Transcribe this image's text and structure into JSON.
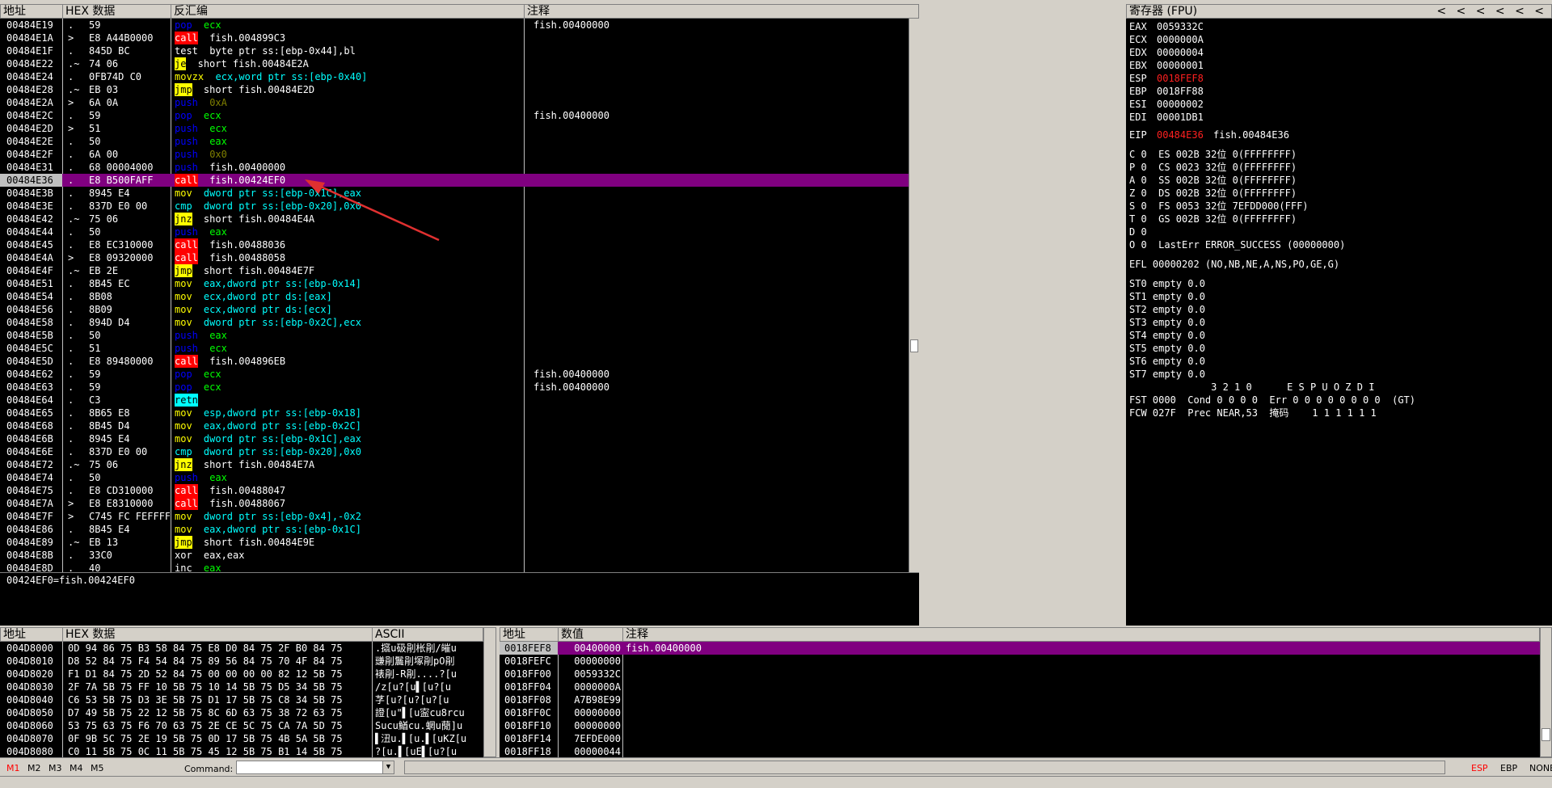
{
  "disasm": {
    "headers": {
      "addr": "地址",
      "hex": "HEX 数据",
      "asm": "反汇编",
      "comment": "注释"
    },
    "rows": [
      {
        "addr": "00484E19",
        "g": ".",
        "hex": "59",
        "mn": "pop",
        "mnc": "pop",
        "ops": "ecx",
        "opc": "reg",
        "cmt": "fish.00400000"
      },
      {
        "addr": "00484E1A",
        "g": ">",
        "hex": "E8 A44B0000",
        "mn": "call",
        "mnc": "call",
        "ops": "fish.004899C3",
        "opc": "",
        "cmt": ""
      },
      {
        "addr": "00484E1F",
        "g": ".",
        "hex": "845D BC",
        "mn": "test",
        "mnc": "test",
        "ops": "byte ptr ss:[ebp-0x44],bl",
        "opc": "",
        "cmt": ""
      },
      {
        "addr": "00484E22",
        "g": ".~",
        "hex": "74 06",
        "mn": "je",
        "mnc": "jcc",
        "ops": "short fish.00484E2A",
        "opc": "",
        "cmt": ""
      },
      {
        "addr": "00484E24",
        "g": ".",
        "hex": "0FB74D C0",
        "mn": "movzx",
        "mnc": "mov",
        "ops": "ecx,word ptr ss:[ebp-0x40]",
        "opc": "mem",
        "cmt": ""
      },
      {
        "addr": "00484E28",
        "g": ".~",
        "hex": "EB 03",
        "mn": "jmp",
        "mnc": "jmp",
        "ops": "short fish.00484E2D",
        "opc": "",
        "cmt": ""
      },
      {
        "addr": "00484E2A",
        "g": ">",
        "hex": "6A 0A",
        "mn": "push",
        "mnc": "push",
        "ops": "0xA",
        "opc": "imm",
        "cmt": ""
      },
      {
        "addr": "00484E2C",
        "g": ".",
        "hex": "59",
        "mn": "pop",
        "mnc": "pop",
        "ops": "ecx",
        "opc": "reg",
        "cmt": "fish.00400000"
      },
      {
        "addr": "00484E2D",
        "g": ">",
        "hex": "51",
        "mn": "push",
        "mnc": "push",
        "ops": "ecx",
        "opc": "reg",
        "cmt": ""
      },
      {
        "addr": "00484E2E",
        "g": ".",
        "hex": "50",
        "mn": "push",
        "mnc": "push",
        "ops": "eax",
        "opc": "reg",
        "cmt": ""
      },
      {
        "addr": "00484E2F",
        "g": ".",
        "hex": "6A 00",
        "mn": "push",
        "mnc": "push",
        "ops": "0x0",
        "opc": "imm",
        "cmt": ""
      },
      {
        "addr": "00484E31",
        "g": ".",
        "hex": "68 00004000",
        "mn": "push",
        "mnc": "push",
        "ops": "fish.00400000",
        "opc": "",
        "cmt": ""
      },
      {
        "addr": "00484E36",
        "g": ".",
        "hex": "E8 B500FAFF",
        "mn": "call",
        "mnc": "call",
        "ops": "fish.00424EF0",
        "opc": "",
        "cmt": "",
        "sel": true
      },
      {
        "addr": "00484E3B",
        "g": ".",
        "hex": "8945 E4",
        "mn": "mov",
        "mnc": "mov",
        "ops": "dword ptr ss:[ebp-0x1C],eax",
        "opc": "mem",
        "cmt": ""
      },
      {
        "addr": "00484E3E",
        "g": ".",
        "hex": "837D E0 00",
        "mn": "cmp",
        "mnc": "cmp",
        "ops": "dword ptr ss:[ebp-0x20],0x0",
        "opc": "mem",
        "cmt": ""
      },
      {
        "addr": "00484E42",
        "g": ".~",
        "hex": "75 06",
        "mn": "jnz",
        "mnc": "jcc",
        "ops": "short fish.00484E4A",
        "opc": "",
        "cmt": ""
      },
      {
        "addr": "00484E44",
        "g": ".",
        "hex": "50",
        "mn": "push",
        "mnc": "push",
        "ops": "eax",
        "opc": "reg",
        "cmt": ""
      },
      {
        "addr": "00484E45",
        "g": ".",
        "hex": "E8 EC310000",
        "mn": "call",
        "mnc": "call",
        "ops": "fish.00488036",
        "opc": "",
        "cmt": ""
      },
      {
        "addr": "00484E4A",
        "g": ">",
        "hex": "E8 09320000",
        "mn": "call",
        "mnc": "call",
        "ops": "fish.00488058",
        "opc": "",
        "cmt": ""
      },
      {
        "addr": "00484E4F",
        "g": ".~",
        "hex": "EB 2E",
        "mn": "jmp",
        "mnc": "jmp",
        "ops": "short fish.00484E7F",
        "opc": "",
        "cmt": ""
      },
      {
        "addr": "00484E51",
        "g": ".",
        "hex": "8B45 EC",
        "mn": "mov",
        "mnc": "mov",
        "ops": "eax,dword ptr ss:[ebp-0x14]",
        "opc": "mem",
        "cmt": ""
      },
      {
        "addr": "00484E54",
        "g": ".",
        "hex": "8B08",
        "mn": "mov",
        "mnc": "mov",
        "ops": "ecx,dword ptr ds:[eax]",
        "opc": "mem",
        "cmt": ""
      },
      {
        "addr": "00484E56",
        "g": ".",
        "hex": "8B09",
        "mn": "mov",
        "mnc": "mov",
        "ops": "ecx,dword ptr ds:[ecx]",
        "opc": "mem",
        "cmt": ""
      },
      {
        "addr": "00484E58",
        "g": ".",
        "hex": "894D D4",
        "mn": "mov",
        "mnc": "mov",
        "ops": "dword ptr ss:[ebp-0x2C],ecx",
        "opc": "mem",
        "cmt": ""
      },
      {
        "addr": "00484E5B",
        "g": ".",
        "hex": "50",
        "mn": "push",
        "mnc": "push",
        "ops": "eax",
        "opc": "reg",
        "cmt": ""
      },
      {
        "addr": "00484E5C",
        "g": ".",
        "hex": "51",
        "mn": "push",
        "mnc": "push",
        "ops": "ecx",
        "opc": "reg",
        "cmt": ""
      },
      {
        "addr": "00484E5D",
        "g": ".",
        "hex": "E8 89480000",
        "mn": "call",
        "mnc": "call",
        "ops": "fish.004896EB",
        "opc": "",
        "cmt": ""
      },
      {
        "addr": "00484E62",
        "g": ".",
        "hex": "59",
        "mn": "pop",
        "mnc": "pop",
        "ops": "ecx",
        "opc": "reg",
        "cmt": "fish.00400000"
      },
      {
        "addr": "00484E63",
        "g": ".",
        "hex": "59",
        "mn": "pop",
        "mnc": "pop",
        "ops": "ecx",
        "opc": "reg",
        "cmt": "fish.00400000"
      },
      {
        "addr": "00484E64",
        "g": ".",
        "hex": "C3",
        "mn": "retn",
        "mnc": "ret",
        "ops": "",
        "opc": "",
        "cmt": ""
      },
      {
        "addr": "00484E65",
        "g": ".",
        "hex": "8B65 E8",
        "mn": "mov",
        "mnc": "mov",
        "ops": "esp,dword ptr ss:[ebp-0x18]",
        "opc": "mem",
        "cmt": ""
      },
      {
        "addr": "00484E68",
        "g": ".",
        "hex": "8B45 D4",
        "mn": "mov",
        "mnc": "mov",
        "ops": "eax,dword ptr ss:[ebp-0x2C]",
        "opc": "mem",
        "cmt": ""
      },
      {
        "addr": "00484E6B",
        "g": ".",
        "hex": "8945 E4",
        "mn": "mov",
        "mnc": "mov",
        "ops": "dword ptr ss:[ebp-0x1C],eax",
        "opc": "mem",
        "cmt": ""
      },
      {
        "addr": "00484E6E",
        "g": ".",
        "hex": "837D E0 00",
        "mn": "cmp",
        "mnc": "cmp",
        "ops": "dword ptr ss:[ebp-0x20],0x0",
        "opc": "mem",
        "cmt": ""
      },
      {
        "addr": "00484E72",
        "g": ".~",
        "hex": "75 06",
        "mn": "jnz",
        "mnc": "jcc",
        "ops": "short fish.00484E7A",
        "opc": "",
        "cmt": ""
      },
      {
        "addr": "00484E74",
        "g": ".",
        "hex": "50",
        "mn": "push",
        "mnc": "push",
        "ops": "eax",
        "opc": "reg",
        "cmt": ""
      },
      {
        "addr": "00484E75",
        "g": ".",
        "hex": "E8 CD310000",
        "mn": "call",
        "mnc": "call",
        "ops": "fish.00488047",
        "opc": "",
        "cmt": ""
      },
      {
        "addr": "00484E7A",
        "g": ">",
        "hex": "E8 E8310000",
        "mn": "call",
        "mnc": "call",
        "ops": "fish.00488067",
        "opc": "",
        "cmt": ""
      },
      {
        "addr": "00484E7F",
        "g": ">",
        "hex": "C745 FC FEFFFFFF",
        "mn": "mov",
        "mnc": "mov",
        "ops": "dword ptr ss:[ebp-0x4],-0x2",
        "opc": "mem",
        "cmt": ""
      },
      {
        "addr": "00484E86",
        "g": ".",
        "hex": "8B45 E4",
        "mn": "mov",
        "mnc": "mov",
        "ops": "eax,dword ptr ss:[ebp-0x1C]",
        "opc": "mem",
        "cmt": ""
      },
      {
        "addr": "00484E89",
        "g": ".~",
        "hex": "EB 13",
        "mn": "jmp",
        "mnc": "jmp",
        "ops": "short fish.00484E9E",
        "opc": "",
        "cmt": ""
      },
      {
        "addr": "00484E8B",
        "g": ".",
        "hex": "33C0",
        "mn": "xor",
        "mnc": "xor",
        "ops": "eax,eax",
        "opc": "",
        "cmt": ""
      },
      {
        "addr": "00484E8D",
        "g": ".",
        "hex": "40",
        "mn": "inc",
        "mnc": "inc",
        "ops": "eax",
        "opc": "reg",
        "cmt": ""
      }
    ]
  },
  "info_line": "00424EF0=fish.00424EF0",
  "registers": {
    "title": "寄存器 (FPU)",
    "nav": "<  <  <  <  <  <",
    "gpr": [
      {
        "n": "EAX",
        "v": "0059332C",
        "t": ""
      },
      {
        "n": "ECX",
        "v": "0000000A",
        "t": ""
      },
      {
        "n": "EDX",
        "v": "00000004",
        "t": ""
      },
      {
        "n": "EBX",
        "v": "00000001",
        "t": ""
      },
      {
        "n": "ESP",
        "v": "0018FEF8",
        "t": "",
        "red": true
      },
      {
        "n": "EBP",
        "v": "0018FF88",
        "t": ""
      },
      {
        "n": "ESI",
        "v": "00000002",
        "t": ""
      },
      {
        "n": "EDI",
        "v": "00001DB1",
        "t": ""
      }
    ],
    "eip": {
      "n": "EIP",
      "v": "00484E36",
      "t": "fish.00484E36"
    },
    "flags": [
      "C 0  ES 002B 32位 0(FFFFFFFF)",
      "P 0  CS 0023 32位 0(FFFFFFFF)",
      "A 0  SS 002B 32位 0(FFFFFFFF)",
      "Z 0  DS 002B 32位 0(FFFFFFFF)",
      "S 0  FS 0053 32位 7EFDD000(FFF)",
      "T 0  GS 002B 32位 0(FFFFFFFF)",
      "D 0",
      "O 0  LastErr ERROR_SUCCESS (00000000)"
    ],
    "efl": "EFL 00000202 (NO,NB,NE,A,NS,PO,GE,G)",
    "st": [
      "ST0 empty 0.0",
      "ST1 empty 0.0",
      "ST2 empty 0.0",
      "ST3 empty 0.0",
      "ST4 empty 0.0",
      "ST5 empty 0.0",
      "ST6 empty 0.0",
      "ST7 empty 0.0"
    ],
    "fpu_hdr": "              3 2 1 0      E S P U O Z D I",
    "fst": "FST 0000  Cond 0 0 0 0  Err 0 0 0 0 0 0 0 0  (GT)",
    "fcw": "FCW 027F  Prec NEAR,53  掩码    1 1 1 1 1 1"
  },
  "dump": {
    "headers": {
      "addr": "地址",
      "hex": "HEX 数据",
      "ascii": "ASCII"
    },
    "rows": [
      {
        "a": "004D8000",
        "h": "0D 94 86 75 B3 58 84 75 E8 D0 84 75 2F B0 84 75",
        "s": ".攨u砐剈枨剈/皠u"
      },
      {
        "a": "004D8010",
        "h": "D8 52 84 75 F4 54 84 75 89 56 84 75 70 4F 84 75",
        "s": "豏剈鬞剈塚剈pO剈"
      },
      {
        "a": "004D8020",
        "h": "F1 D1 84 75 2D 52 84 75 00 00 00 00 82 12 5B 75",
        "s": "裱剈-R剈....?[u"
      },
      {
        "a": "004D8030",
        "h": "2F 7A 5B 75 FF 10 5B 75 10 14 5B 75 D5 34 5B 75",
        "s": "/z[u?[u▌[u?[u"
      },
      {
        "a": "004D8040",
        "h": "C6 53 5B 75 D3 3E 5B 75 D1 17 5B 75 C8 34 5B 75",
        "s": "芓[u?[u?[u?[u"
      },
      {
        "a": "004D8050",
        "h": "D7 49 5B 75 22 12 5B 75 8C 6D 63 75 38 72 63 75",
        "s": "證[u\"▌[u寍cu8rcu"
      },
      {
        "a": "004D8060",
        "h": "53 75 63 75 F6 70 63 75 2E CE 5C 75 CA 7A 5D 75",
        "s": "Sucu鰌cu.蝄u蕑]u"
      },
      {
        "a": "004D8070",
        "h": "0F 9B 5C 75 2E 19 5B 75 0D 17 5B 75 4B 5A 5B 75",
        "s": "▌沑u.▌[u.▌[uKZ[u"
      },
      {
        "a": "004D8080",
        "h": "C0 11 5B 75 0C 11 5B 75 45 12 5B 75 B1 14 5B 75",
        "s": "?[u.▌[uE▌[u?[u"
      }
    ]
  },
  "stack": {
    "headers": {
      "addr": "地址",
      "val": "数值",
      "cmt": "注释"
    },
    "rows": [
      {
        "a": "0018FEF8",
        "v": "00400000",
        "c": "fish.00400000",
        "sel": true
      },
      {
        "a": "0018FEFC",
        "v": "00000000",
        "c": ""
      },
      {
        "a": "0018FF00",
        "v": "0059332C",
        "c": ""
      },
      {
        "a": "0018FF04",
        "v": "0000000A",
        "c": ""
      },
      {
        "a": "0018FF08",
        "v": "A7B98E99",
        "c": ""
      },
      {
        "a": "0018FF0C",
        "v": "00000000",
        "c": ""
      },
      {
        "a": "0018FF10",
        "v": "00000000",
        "c": ""
      },
      {
        "a": "0018FF14",
        "v": "7EFDE000",
        "c": ""
      },
      {
        "a": "0018FF18",
        "v": "00000044",
        "c": ""
      }
    ]
  },
  "bottom": {
    "tabs": [
      "M1",
      "M2",
      "M3",
      "M4",
      "M5"
    ],
    "command_label": "Command:",
    "right": [
      "ESP",
      "EBP",
      "NONE"
    ]
  },
  "colors": {
    "selection": "#800080",
    "call": "#ff0000",
    "jump": "#ffff00",
    "ret": "#00ffff",
    "arrow": "#e03030"
  }
}
